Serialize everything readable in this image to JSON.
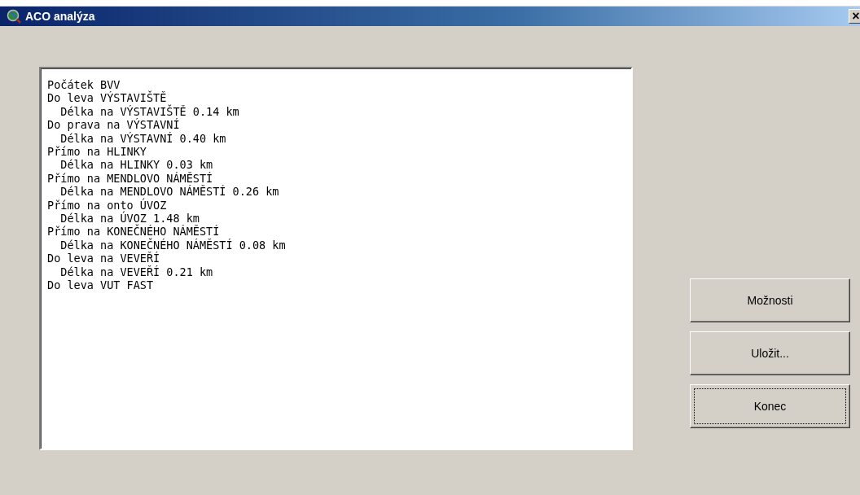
{
  "window": {
    "title": "ACO analýza",
    "close_label": "×"
  },
  "output": {
    "lines": [
      "Počátek BVV",
      "Do leva VÝSTAVIŠTĚ",
      "  Délka na VÝSTAVIŠTĚ 0.14 km",
      "Do prava na VÝSTAVNÍ",
      "  Délka na VÝSTAVNÍ 0.40 km",
      "Přímo na HLINKY",
      "  Délka na HLINKY 0.03 km",
      "Přímo na MENDLOVO NÁMĚSTÍ",
      "  Délka na MENDLOVO NÁMĚSTÍ 0.26 km",
      "Přímo na onto ÚVOZ",
      "  Délka na ÚVOZ 1.48 km",
      "Přímo na KONEČNÉHO NÁMĚSTÍ",
      "  Délka na KONEČNÉHO NÁMĚSTÍ 0.08 km",
      "Do leva na VEVEŘÍ",
      "  Délka na VEVEŘÍ 0.21 km",
      "Do leva VUT FAST"
    ]
  },
  "buttons": [
    {
      "label": "Možnosti",
      "focused": false
    },
    {
      "label": "Uložit...",
      "focused": false
    },
    {
      "label": "Konec",
      "focused": true
    }
  ]
}
